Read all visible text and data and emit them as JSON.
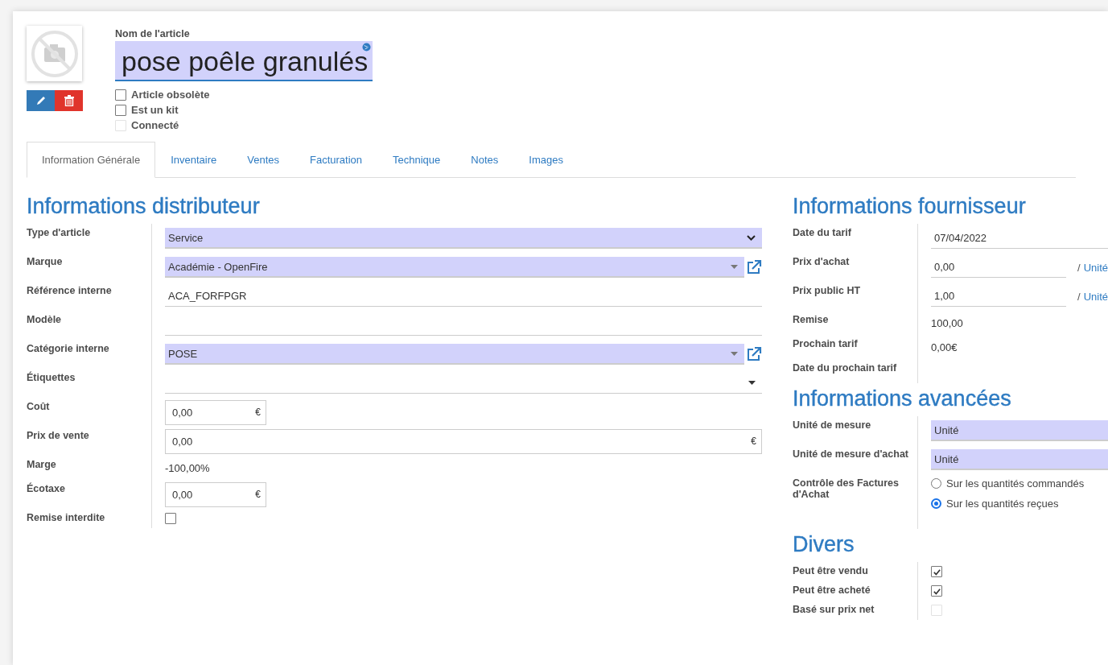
{
  "header": {
    "name_label": "Nom de l'article",
    "name": "pose poêle granulés",
    "flags": [
      {
        "label": "Article obsolète",
        "checked": false,
        "disabled": false
      },
      {
        "label": "Est un kit",
        "checked": false,
        "disabled": false
      },
      {
        "label": "Connecté",
        "checked": false,
        "disabled": true
      }
    ]
  },
  "tabs": [
    {
      "label": "Information Générale",
      "selected": true
    },
    {
      "label": "Inventaire",
      "selected": false
    },
    {
      "label": "Ventes",
      "selected": false
    },
    {
      "label": "Facturation",
      "selected": false
    },
    {
      "label": "Technique",
      "selected": false
    },
    {
      "label": "Notes",
      "selected": false
    },
    {
      "label": "Images",
      "selected": false
    }
  ],
  "left_sections": [
    {
      "title": "Informations distributeur",
      "rows": [
        {
          "label": "Type d'article",
          "kind": "select",
          "value": "Service",
          "required": true
        },
        {
          "label": "Marque",
          "kind": "many2one",
          "value": "Académie - OpenFire",
          "required": true
        },
        {
          "label": "Référence interne",
          "kind": "input",
          "value": "ACA_FORFPGR",
          "required": false
        },
        {
          "label": "Modèle",
          "kind": "input",
          "required": false
        },
        {
          "label": "Catégorie interne",
          "kind": "many2one",
          "value": "POSE",
          "required": true
        },
        {
          "label": "Étiquettes",
          "kind": "tags",
          "required": false
        },
        {
          "label": "Coût",
          "kind": "monetary",
          "value": "0,00",
          "currency": "€",
          "wide": false
        },
        {
          "label": "Prix de vente",
          "kind": "monetary",
          "value": "0,00",
          "currency": "€",
          "wide": true
        },
        {
          "label": "Marge",
          "kind": "text",
          "value": "-100,00%"
        },
        {
          "label": "Écotaxe",
          "kind": "monetary",
          "value": "0,00",
          "currency": "€",
          "wide": false
        },
        {
          "label": "Remise interdite",
          "kind": "checkbox",
          "checked": false,
          "disabled": false
        }
      ]
    }
  ],
  "right_sections": [
    {
      "title": "Informations fournisseur",
      "rows": [
        {
          "label": "Date du tarif",
          "kind": "input",
          "value": "07/04/2022",
          "required": false
        },
        {
          "label": "Prix d'achat",
          "kind": "unit_input",
          "value": "0,00",
          "separator": "/",
          "unit": "Unité"
        },
        {
          "label": "Prix public HT",
          "kind": "unit_input",
          "value": "1,00",
          "separator": "/",
          "unit": "Unité"
        },
        {
          "label": "Remise",
          "kind": "text",
          "value": "100,00"
        },
        {
          "label": "Prochain tarif",
          "kind": "text",
          "value": "0,00€"
        },
        {
          "label": "Date du prochain tarif",
          "kind": "text"
        }
      ]
    },
    {
      "title": "Informations avancées",
      "rows": [
        {
          "label": "Unité de mesure",
          "kind": "input",
          "value": "Unité",
          "required": true
        },
        {
          "label": "Unité de mesure d'achat",
          "kind": "input",
          "value": "Unité",
          "required": true
        },
        {
          "label": "Contrôle des Factures d'Achat",
          "kind": "radio",
          "options": [
            {
              "label": "Sur les quantités commandés",
              "selected": false
            },
            {
              "label": "Sur les quantités reçues",
              "selected": true
            }
          ]
        }
      ]
    },
    {
      "title": "Divers",
      "rows": [
        {
          "label": "Peut être vendu",
          "kind": "checkbox",
          "checked": true,
          "disabled": false
        },
        {
          "label": "Peut être acheté",
          "kind": "checkbox",
          "checked": true,
          "disabled": false
        },
        {
          "label": "Basé sur prix net",
          "kind": "checkbox",
          "checked": false,
          "disabled": true
        }
      ]
    }
  ]
}
